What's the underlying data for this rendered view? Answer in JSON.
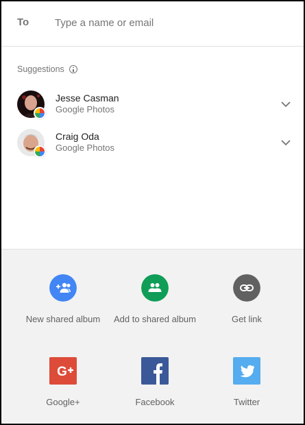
{
  "recipient": {
    "label": "To",
    "placeholder": "Type a name or email"
  },
  "suggestions": {
    "header": "Suggestions",
    "contacts": [
      {
        "name": "Jesse Casman",
        "source": "Google Photos"
      },
      {
        "name": "Craig Oda",
        "source": "Google Photos"
      }
    ]
  },
  "share": {
    "row1": [
      {
        "label": "New shared album",
        "color": "#4285f4",
        "icon": "group-add-icon"
      },
      {
        "label": "Add to shared album",
        "color": "#0f9d58",
        "icon": "group-icon"
      },
      {
        "label": "Get link",
        "color": "#616161",
        "icon": "link-icon"
      }
    ],
    "row2": [
      {
        "label": "Google+",
        "color": "#dd4b39",
        "icon": "google-plus-icon"
      },
      {
        "label": "Facebook",
        "color": "#3b5998",
        "icon": "facebook-icon"
      },
      {
        "label": "Twitter",
        "color": "#55acee",
        "icon": "twitter-icon"
      }
    ]
  }
}
